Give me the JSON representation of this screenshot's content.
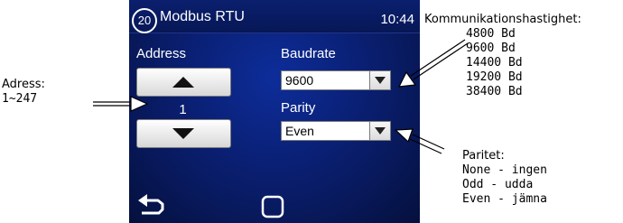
{
  "header": {
    "screen_number": "20",
    "title": "Modbus RTU",
    "time": "10:44"
  },
  "address": {
    "label": "Address",
    "value": "1",
    "up_icon": "triangle-up-icon",
    "down_icon": "triangle-down-icon"
  },
  "baudrate": {
    "label": "Baudrate",
    "value": "9600"
  },
  "parity": {
    "label": "Parity",
    "value": "Even"
  },
  "nav": {
    "back_icon": "back-arrow-icon",
    "home_icon": "square-icon"
  },
  "annotations": {
    "address": {
      "title": "Adress:",
      "range": "1~247"
    },
    "baudrate": {
      "title": "Kommunikationshastighet:",
      "options": [
        "4800 Bd",
        "9600 Bd",
        "14400 Bd",
        "19200 Bd",
        "38400 Bd"
      ]
    },
    "parity": {
      "title": "Paritet:",
      "options": [
        "None - ingen",
        "Odd - udda",
        "Even - jämna"
      ]
    }
  },
  "colors": {
    "screen_background": "#0a1f72",
    "text": "#ffffff",
    "button_face": "#e8e8e8"
  }
}
